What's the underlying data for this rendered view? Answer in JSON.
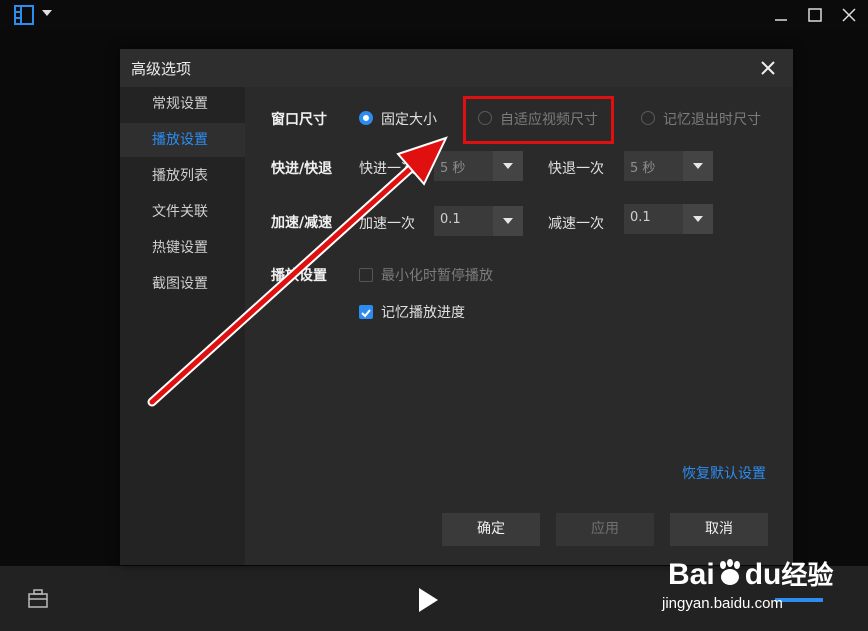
{
  "dialog": {
    "title": "高级选项",
    "sidebar": [
      {
        "label": "常规设置",
        "active": false
      },
      {
        "label": "播放设置",
        "active": true
      },
      {
        "label": "播放列表",
        "active": false
      },
      {
        "label": "文件关联",
        "active": false
      },
      {
        "label": "热键设置",
        "active": false
      },
      {
        "label": "截图设置",
        "active": false
      }
    ],
    "window_size": {
      "label": "窗口尺寸",
      "options": [
        "固定大小",
        "自适应视频尺寸",
        "记忆退出时尺寸"
      ],
      "selected": "固定大小"
    },
    "seek": {
      "label": "快进/快退",
      "forward_label": "快进一次",
      "forward_value": "5 秒",
      "backward_label": "快退一次",
      "backward_value": "5 秒"
    },
    "speed": {
      "label": "加速/减速",
      "up_label": "加速一次",
      "up_value": "0.1",
      "down_label": "减速一次",
      "down_value": "0.1"
    },
    "playback": {
      "label": "播放设置",
      "pause_minimize": "最小化时暂停播放",
      "pause_minimize_checked": false,
      "remember_progress": "记忆播放进度",
      "remember_progress_checked": true
    },
    "restore_defaults": "恢复默认设置",
    "buttons": {
      "ok": "确定",
      "apply": "应用",
      "cancel": "取消"
    }
  },
  "watermark": {
    "brand": "Bai",
    "brand2": "du",
    "suffix": "经验",
    "url": "jingyan.baidu.com"
  },
  "colors": {
    "accent": "#2d8cf0",
    "highlight": "#e01010",
    "arrow": "#e01010"
  }
}
